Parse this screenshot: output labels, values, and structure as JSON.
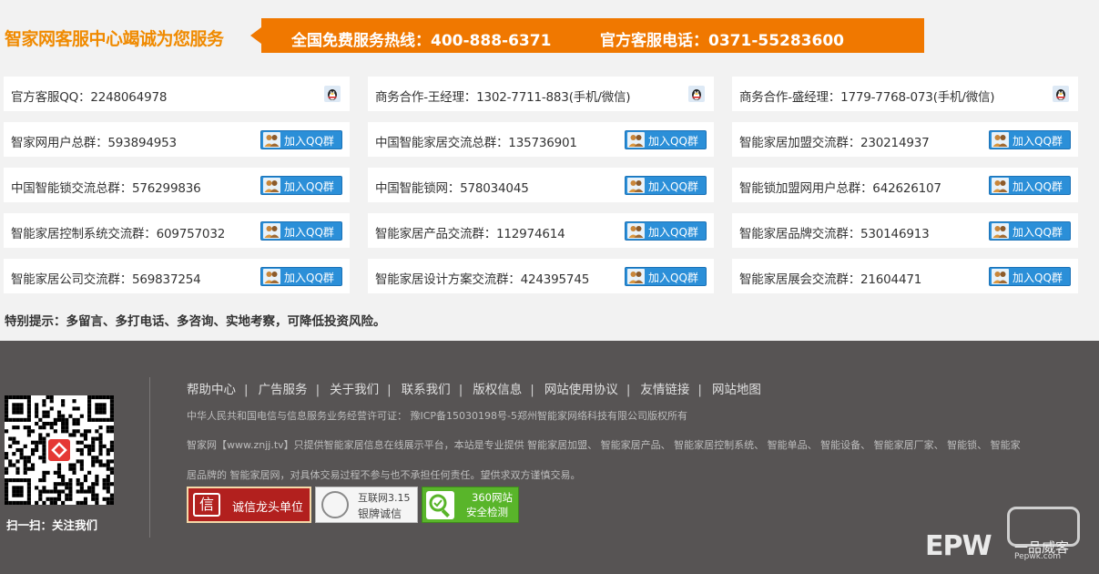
{
  "header": {
    "slogan": "智家网客服中心竭诚为您服务",
    "hotline": "全国免费服务热线：400-888-6371",
    "service_phone": "官方客服电话：0371-55283600"
  },
  "contacts": [
    [
      {
        "text": "官方客服QQ：2248064978",
        "action": "qq"
      },
      {
        "text": "商务合作-王经理：1302-7711-883(手机/微信)",
        "action": "qq"
      },
      {
        "text": "商务合作-盛经理：1779-7768-073(手机/微信)",
        "action": "qq"
      }
    ],
    [
      {
        "text": "智家网用户总群：593894953",
        "action": "join"
      },
      {
        "text": "中国智能家居交流总群：135736901",
        "action": "join"
      },
      {
        "text": "智能家居加盟交流群：230214937",
        "action": "join"
      }
    ],
    [
      {
        "text": "中国智能锁交流总群：576299836",
        "action": "join"
      },
      {
        "text": "中国智能锁网：578034045",
        "action": "join"
      },
      {
        "text": "智能锁加盟网用户总群：642626107",
        "action": "join"
      }
    ],
    [
      {
        "text": "智能家居控制系统交流群：609757032",
        "action": "join"
      },
      {
        "text": "智能家居产品交流群：112974614",
        "action": "join"
      },
      {
        "text": "智能家居品牌交流群：530146913",
        "action": "join"
      }
    ],
    [
      {
        "text": "智能家居公司交流群：569837254",
        "action": "join"
      },
      {
        "text": "智能家居设计方案交流群：424395745",
        "action": "join"
      },
      {
        "text": "智能家居展会交流群：21604471",
        "action": "join"
      }
    ]
  ],
  "join_button_label": "加入QQ群",
  "tip": "特别提示：多留言、多打电话、多咨询、实地考察，可降低投资风险。",
  "footer": {
    "nav": [
      "帮助中心",
      "广告服务",
      "关于我们",
      "联系我们",
      "版权信息",
      "网站使用协议",
      "友情链接",
      "网站地图"
    ],
    "license": "中华人民共和国电信与信息服务业务经营许可证： 豫ICP备15030198号-5郑州智能家网络科技有限公司版权所有",
    "desc_line1": "智家网【www.znjj.tv】只提供智能家居信息在线展示平台，本站是专业提供 智能家居加盟、 智能家居产品、 智能家居控制系统、 智能单品、 智能设备、 智能家居厂家、 智能锁、 智能家",
    "desc_line2": "居品牌的 智能家居网，对具体交易过程不参与也不承担任何责任。望供求双方谨慎交易。",
    "qr_label": "扫一扫：关注我们",
    "badges": {
      "b1": "诚信龙头单位",
      "b1_icon": "信",
      "b2_line1": "互联网3.15",
      "b2_line2": "银牌诚信",
      "b3_line1": "360网站",
      "b3_line2": "安全检测"
    },
    "watermark": {
      "logo": "EPW",
      "brand": "一品威客",
      "url": "Pepwk.com"
    }
  },
  "colors": {
    "accent_orange": "#f07800",
    "footer_bg": "#575454",
    "join_blue": "#2b8fd8"
  }
}
